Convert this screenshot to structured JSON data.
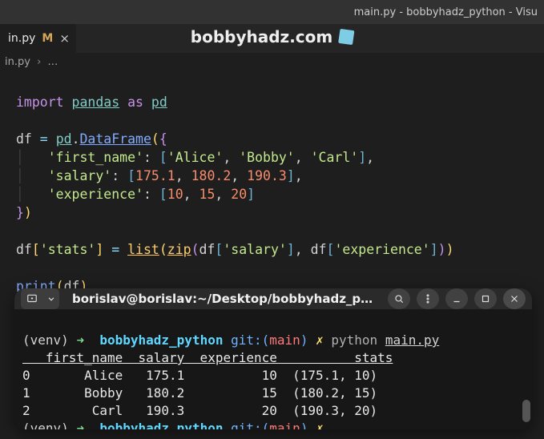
{
  "window": {
    "title": "main.py - bobbyhadz_python - Visu"
  },
  "tab": {
    "filename": "in.py",
    "modified_indicator": "M",
    "close_glyph": "×"
  },
  "watermark": {
    "text": "bobbyhadz.com"
  },
  "breadcrumb": {
    "file": "in.py",
    "sep": "›",
    "rest": "…"
  },
  "code": {
    "l1_import": "import",
    "l1_pandas": "pandas",
    "l1_as": "as",
    "l1_pd": "pd",
    "l3_df": "df",
    "l3_eq": " = ",
    "l3_pd": "pd",
    "l3_dot": ".",
    "l3_DataFrame": "DataFrame",
    "l4_key": "'first_name'",
    "l4_v1": "'Alice'",
    "l4_v2": "'Bobby'",
    "l4_v3": "'Carl'",
    "l5_key": "'salary'",
    "l5_v1": "175.1",
    "l5_v2": "180.2",
    "l5_v3": "190.3",
    "l6_key": "'experience'",
    "l6_v1": "10",
    "l6_v2": "15",
    "l6_v3": "20",
    "l8_stats": "'stats'",
    "l8_list": "list",
    "l8_zip": "zip",
    "l8_salary": "'salary'",
    "l8_exp": "'experience'",
    "l10_print": "print",
    "l10_df": "df"
  },
  "terminal": {
    "title": "borislav@borislav:~/Desktop/bobbyhadz_pyt…",
    "venv": "(venv)",
    "arrow": "➜",
    "project": "bobbyhadz_python",
    "git_label": "git:(",
    "branch": "main",
    "git_close": ")",
    "x": "✗",
    "cmd_python": "python",
    "cmd_file": "main.py",
    "header": "   first_name  salary  experience          stats",
    "row0": "0       Alice   175.1          10  (175.1, 10)",
    "row1": "1       Bobby   180.2          15  (180.2, 15)",
    "row2": "2        Carl   190.3          20  (190.3, 20)"
  }
}
